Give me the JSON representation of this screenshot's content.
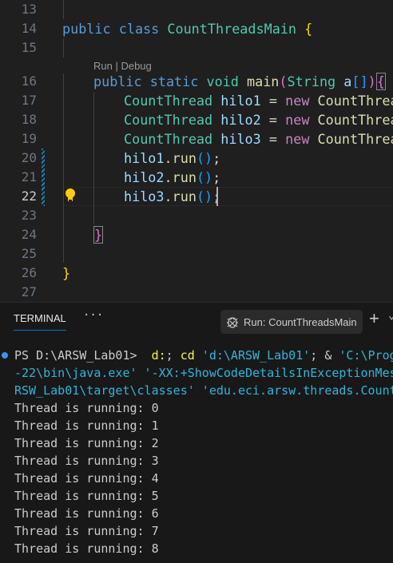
{
  "editor": {
    "line_numbers": [
      "13",
      "14",
      "15",
      "16",
      "17",
      "18",
      "19",
      "20",
      "21",
      "22",
      "23",
      "24",
      "25",
      "26",
      "27"
    ],
    "current_line": "22",
    "codelens": "Run | Debug",
    "code": {
      "l14": {
        "kw1": "public",
        "kw2": "class",
        "name": "CountThreadsMain",
        "brace": "{"
      },
      "l16": {
        "kw1": "public",
        "kw2": "static",
        "kw3": "void",
        "fn": "main",
        "p1": "(",
        "type": "String",
        "arg": "a",
        "br": "[]",
        "p2": ")",
        "brace": "{"
      },
      "l17": {
        "type": "CountThread",
        "var": "hilo1",
        "eq": "=",
        "new": "new",
        "ctor": "CountThread"
      },
      "l18": {
        "type": "CountThread",
        "var": "hilo2",
        "eq": "=",
        "new": "new",
        "ctor": "CountThread"
      },
      "l19": {
        "type": "CountThread",
        "var": "hilo3",
        "eq": "=",
        "new": "new",
        "ctor": "CountThread"
      },
      "l20": {
        "var": "hilo1",
        "call": ".run",
        "paren": "()",
        "semi": ";"
      },
      "l21": {
        "var": "hilo2",
        "call": ".run",
        "paren": "()",
        "semi": ";"
      },
      "l22": {
        "var": "hilo3",
        "call": ".run",
        "paren": "()",
        "semi": ";"
      },
      "l24": "}",
      "l26": "}"
    }
  },
  "panel": {
    "tab": "TERMINAL",
    "more": "···",
    "run_label": "Run: CountThreadsMain",
    "plus": "+",
    "chevron": "⌄",
    "prompt": "PS D:\\ARSW_Lab01> ",
    "cmd1": " d:",
    "cmd2": "; ",
    "cmd3": "cd",
    "cmd4": " 'd:\\ARSW_Lab01'",
    "cmd5": "; & ",
    "cmd6": "'C:\\Prog",
    "line2": "-22\\bin\\java.exe' '-XX:+ShowCodeDetailsInExceptionMes",
    "line3": "RSW_Lab01\\target\\classes' 'edu.eci.arsw.threads.Count",
    "output": [
      "Thread is running: 0",
      "Thread is running: 1",
      "Thread is running: 2",
      "Thread is running: 3",
      "Thread is running: 4",
      "Thread is running: 5",
      "Thread is running: 6",
      "Thread is running: 7",
      "Thread is running: 8"
    ]
  }
}
